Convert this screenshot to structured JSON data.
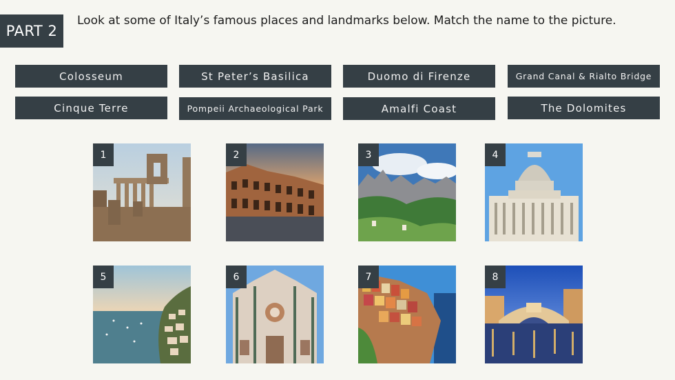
{
  "header": {
    "part_label": "PART 2",
    "instruction": "Look at some of Italy’s famous places and landmarks below. Match the name to the picture."
  },
  "name_buttons": [
    "Colosseum",
    "St Peter’s Basilica",
    "Duomo di Firenze",
    "Grand Canal & Rialto Bridge",
    "Cinque Terre",
    "Pompeii Archaeological Park",
    "Amalfi Coast",
    "The Dolomites"
  ],
  "pictures": [
    {
      "number": "1"
    },
    {
      "number": "2"
    },
    {
      "number": "3"
    },
    {
      "number": "4"
    },
    {
      "number": "5"
    },
    {
      "number": "6"
    },
    {
      "number": "7"
    },
    {
      "number": "8"
    }
  ],
  "colors": {
    "background": "#f6f6f1",
    "label_fill": "#353f45",
    "label_text": "#f2f2f2"
  }
}
